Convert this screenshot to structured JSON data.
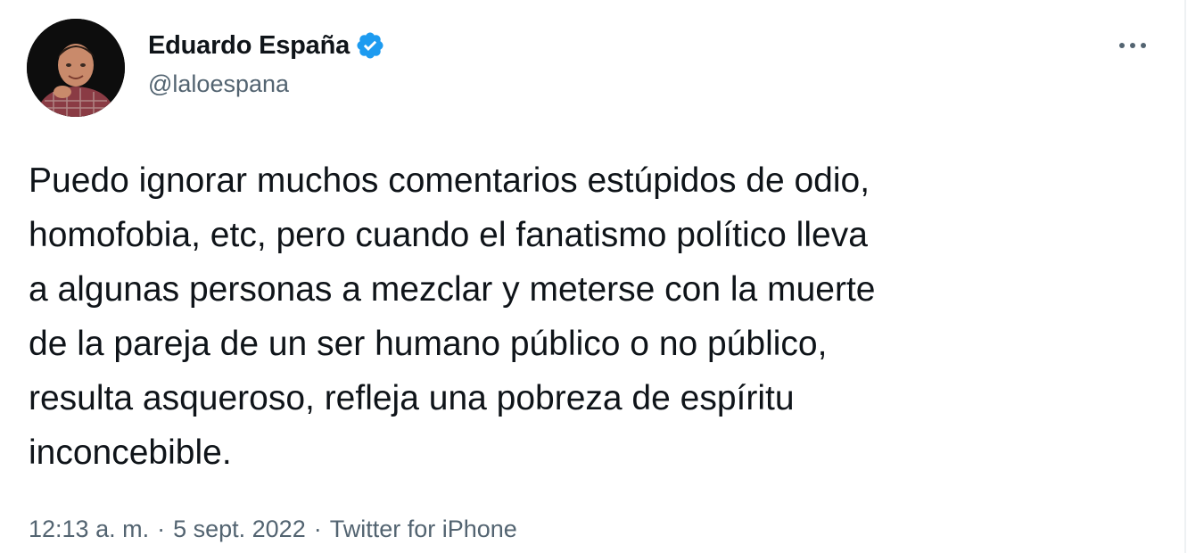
{
  "tweet": {
    "author": {
      "display_name": "Eduardo España",
      "handle": "@laloespana",
      "verified": true,
      "verified_icon": "verified-badge-icon",
      "avatar": "profile-photo"
    },
    "more_icon": "more-options-icon",
    "text": "Puedo ignorar muchos comentarios estúpidos de odio,\nhomofobia, etc, pero cuando el fanatismo político lleva\na algunas personas a mezclar y meterse con la muerte\nde la pareja de un ser humano público o no público,\nresulta asqueroso, refleja una pobreza de espíritu\ninconcebible.",
    "meta": {
      "time": "12:13 a. m.",
      "separator": "·",
      "date": "5 sept. 2022",
      "source": "Twitter for iPhone"
    }
  },
  "colors": {
    "text": "#0f1419",
    "secondary": "#536471",
    "verified_blue": "#1d9bf0",
    "background": "#ffffff"
  }
}
